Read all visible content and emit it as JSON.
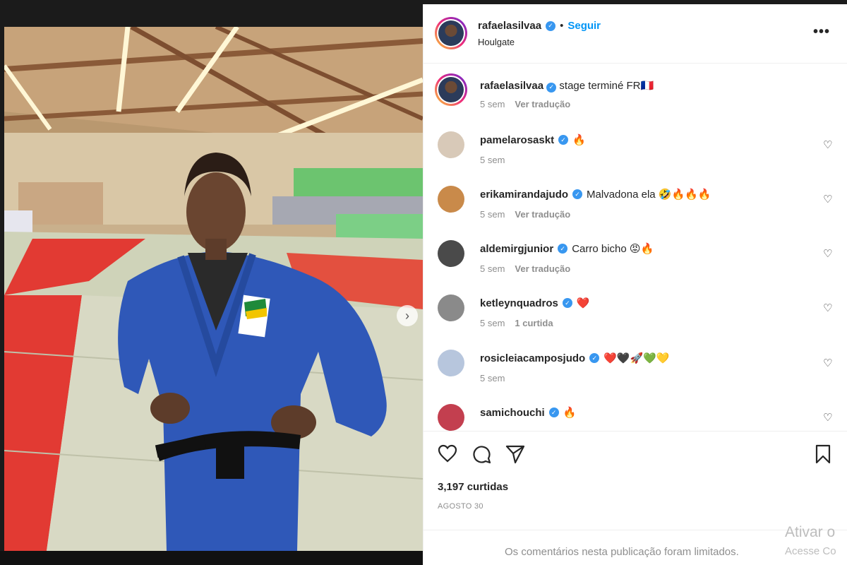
{
  "post": {
    "author": "rafaelasilvaa",
    "follow_label": "Seguir",
    "bullet": "•",
    "location": "Houlgate",
    "more_label": "•••",
    "caption_text": "stage terminé FR🇫🇷",
    "caption_time": "5 sem",
    "caption_translate": "Ver tradução"
  },
  "comments": [
    {
      "user": "pamelarosaskt",
      "text": "🔥",
      "time": "5 sem",
      "extra": ""
    },
    {
      "user": "erikamirandajudo",
      "text": "Malvadona ela 🤣🔥🔥🔥",
      "time": "5 sem",
      "extra": "Ver tradução"
    },
    {
      "user": "aldemirgjunior",
      "text": "Carro bicho 😡🔥",
      "time": "5 sem",
      "extra": "Ver tradução"
    },
    {
      "user": "ketleynquadros",
      "text": "❤️",
      "time": "5 sem",
      "extra": "1 curtida"
    },
    {
      "user": "rosicleiacamposjudo",
      "text": "❤️🖤🚀💚💛",
      "time": "5 sem",
      "extra": ""
    },
    {
      "user": "samichouchi",
      "text": "🔥",
      "time": "",
      "extra": ""
    }
  ],
  "stats": {
    "likes": "3,197 curtidas",
    "date": "AGOSTO 30"
  },
  "footer": {
    "limited": "Os comentários nesta publicação foram limitados."
  },
  "watermark": {
    "line1": "Ativar o",
    "line2": "Acesse Co"
  },
  "carousel": {
    "total_slides": 8,
    "active_slide": 1
  },
  "colors": {
    "accent": "#0095f6",
    "verified": "#3897f0",
    "muted": "#8e8e8e"
  }
}
